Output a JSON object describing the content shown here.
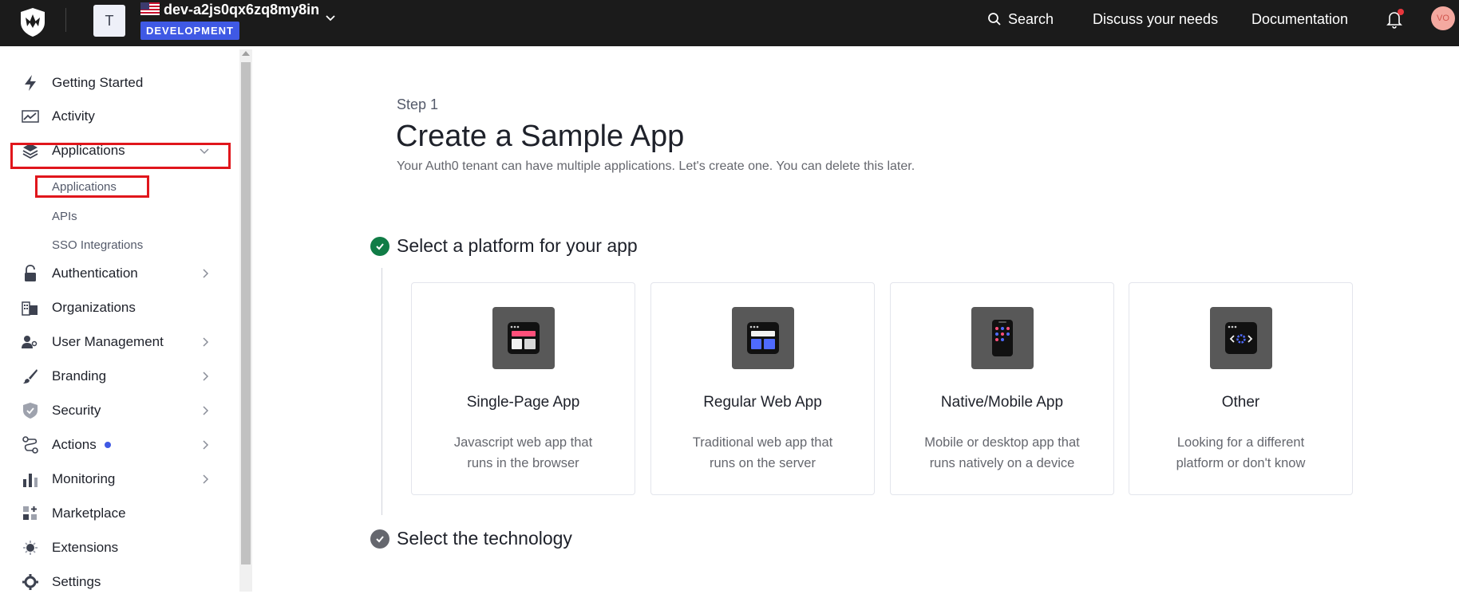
{
  "header": {
    "tenant_initial": "T",
    "tenant_name": "dev-a2js0qx6zq8my8in",
    "environment": "DEVELOPMENT",
    "search_label": "Search",
    "discuss_label": "Discuss your needs",
    "docs_label": "Documentation",
    "user_initials": "VO"
  },
  "sidebar": {
    "items": [
      {
        "label": "Getting Started",
        "icon": "lightning-icon"
      },
      {
        "label": "Activity",
        "icon": "activity-chart-icon"
      },
      {
        "label": "Applications",
        "icon": "layers-icon"
      },
      {
        "label": "Authentication",
        "icon": "lock-icon"
      },
      {
        "label": "Organizations",
        "icon": "building-icon"
      },
      {
        "label": "User Management",
        "icon": "users-icon"
      },
      {
        "label": "Branding",
        "icon": "brush-icon"
      },
      {
        "label": "Security",
        "icon": "shield-icon"
      },
      {
        "label": "Actions",
        "icon": "flow-icon"
      },
      {
        "label": "Monitoring",
        "icon": "bar-chart-icon"
      },
      {
        "label": "Marketplace",
        "icon": "grid-plus-icon"
      },
      {
        "label": "Extensions",
        "icon": "puzzle-icon"
      },
      {
        "label": "Settings",
        "icon": "gear-icon"
      }
    ],
    "sub_items": [
      "Applications",
      "APIs",
      "SSO Integrations"
    ]
  },
  "main": {
    "step": "Step 1",
    "title": "Create a Sample App",
    "description": "Your Auth0 tenant can have multiple applications. Let's create one. You can delete this later.",
    "section1_title": "Select a platform for your app",
    "section2_title": "Select the technology",
    "cards": [
      {
        "title": "Single-Page App",
        "line1": "Javascript web app that",
        "line2": "runs in the browser"
      },
      {
        "title": "Regular Web App",
        "line1": "Traditional web app that",
        "line2": "runs on the server"
      },
      {
        "title": "Native/Mobile App",
        "line1": "Mobile or desktop app that",
        "line2": "runs natively on a device"
      },
      {
        "title": "Other",
        "line1": "Looking for a different",
        "line2": "platform or don't know"
      }
    ]
  },
  "colors": {
    "topbar": "#1b1b1b",
    "badge": "#3f59e4",
    "highlight": "#e0161c",
    "step_complete": "#107c46",
    "step_pending": "#65676e"
  }
}
